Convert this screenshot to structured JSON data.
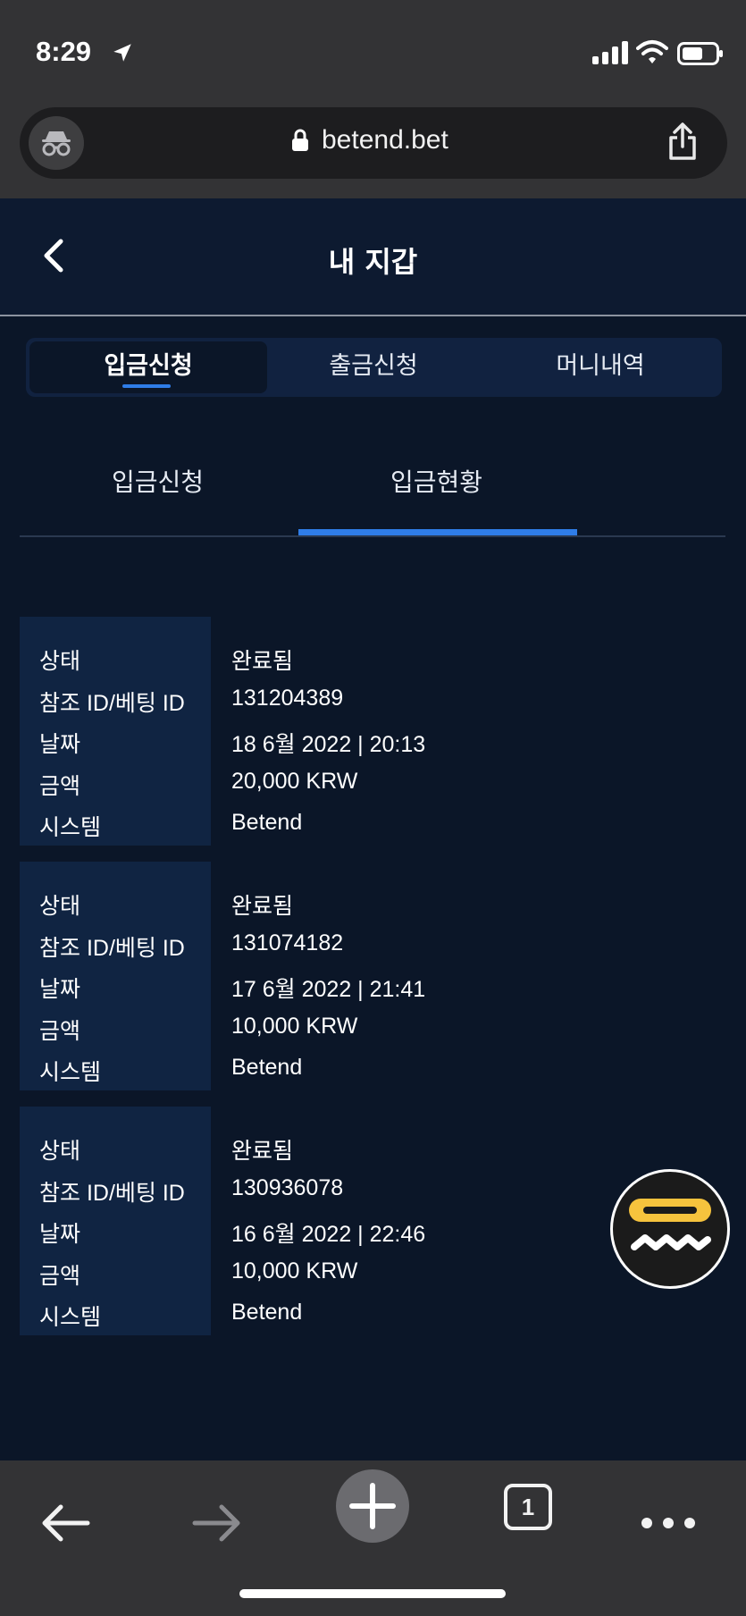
{
  "status_bar": {
    "time": "8:29"
  },
  "browser": {
    "url": "betend.bet",
    "tab_count": "1"
  },
  "header": {
    "title": "내 지갑"
  },
  "main_tabs": [
    {
      "label": "입금신청",
      "active": true
    },
    {
      "label": "출금신청",
      "active": false
    },
    {
      "label": "머니내역",
      "active": false
    }
  ],
  "sub_tabs": [
    {
      "label": "입금신청",
      "active": false
    },
    {
      "label": "입금현황",
      "active": true
    }
  ],
  "field_labels": {
    "status": "상태",
    "ref_id": "참조 ID/베팅 ID",
    "date": "날짜",
    "amount": "금액",
    "system": "시스템"
  },
  "records": [
    {
      "status": "완료됨",
      "ref_id": "131204389",
      "date": "18 6월 2022 | 20:13",
      "amount": "20,000 KRW",
      "system": "Betend"
    },
    {
      "status": "완료됨",
      "ref_id": "131074182",
      "date": "17 6월 2022 | 21:41",
      "amount": "10,000 KRW",
      "system": "Betend"
    },
    {
      "status": "완료됨",
      "ref_id": "130936078",
      "date": "16 6월 2022 | 22:46",
      "amount": "10,000 KRW",
      "system": "Betend"
    }
  ],
  "colors": {
    "background": "#0b1628",
    "accent": "#2f7de8",
    "label_panel": "#102442",
    "browser_chrome": "#333335",
    "widget_yellow": "#f6c33d"
  }
}
